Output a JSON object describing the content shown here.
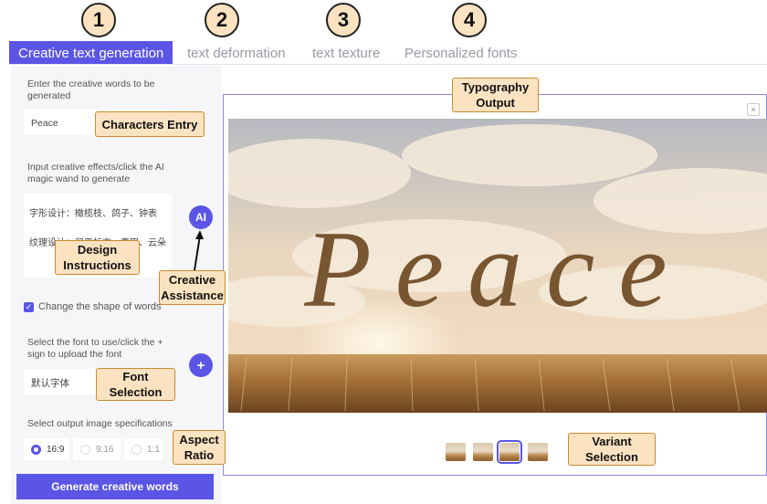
{
  "steps": [
    "1",
    "2",
    "3",
    "4"
  ],
  "tabs": [
    {
      "label": "Creative text generation",
      "active": true
    },
    {
      "label": "text deformation",
      "active": false
    },
    {
      "label": "text texture",
      "active": false
    },
    {
      "label": "Personalized fonts",
      "active": false
    }
  ],
  "form": {
    "words_label": "Enter the creative words to be generated",
    "words_value": "Peace",
    "effects_label": "Input creative effects/click the AI magic wand to generate",
    "effects_line1": "字形设计：橄榄枝、鸽子、钟表",
    "effects_line2": "纹理设计：和平标志、麦田、云朵",
    "ai_button": "AI",
    "shape_checkbox_label": "Change the shape of words",
    "shape_checked": true,
    "font_label": "Select the font to use/click the + sign to upload the font",
    "font_value": "默认字体",
    "add_font_button": "+",
    "spec_label": "Select output image specifications",
    "ratios": [
      "16:9",
      "9:16",
      "1:1"
    ],
    "selected_ratio": "16:9",
    "generate_button": "Generate creative words"
  },
  "output": {
    "close": "×",
    "artwork_word": "Peace",
    "thumbnail_count": 4,
    "selected_thumbnail": 3
  },
  "callouts": {
    "characters_entry": "Characters Entry",
    "design_instructions": "Design\nInstructions",
    "creative_assistance": "Creative\nAssistance",
    "font_selection": "Font\nSelection",
    "aspect_ratio": "Aspect\nRatio",
    "typography_output": "Typography\nOutput",
    "variant_selection": "Variant\nSelection"
  },
  "colors": {
    "accent": "#5b55e6",
    "callout_fill": "#fbe3c2",
    "callout_border": "#c98a2e",
    "letter_brown": "#6e4a24"
  }
}
